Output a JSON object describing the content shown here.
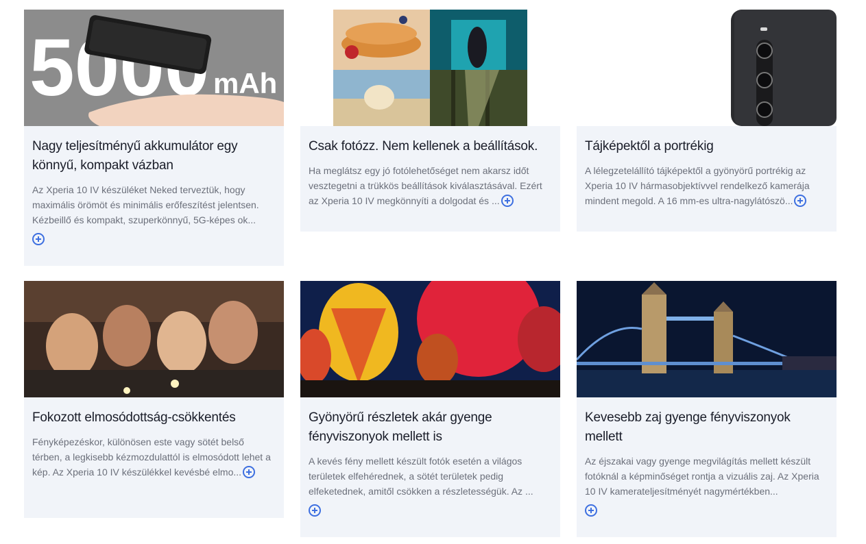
{
  "cards": [
    {
      "title": "Nagy teljesítményű akkumulátor egy könnyű, kompakt vázban",
      "text": "Az Xperia 10 IV készüléket Neked terveztük, hogy maximális örömöt és minimális erőfeszítést jelentsen. Kézbeillő és kompakt, szuperkönnyű, 5G-képes ok...",
      "image_label_big": "5000",
      "image_label_unit": "mAh",
      "more_icon": "plus-circle-icon"
    },
    {
      "title": "Csak fotózz. Nem kellenek a beállítások.",
      "text": "Ha meglátsz egy jó fotólehetőséget nem akarsz időt vesztegetni a trükkös beállítások kiválasztásával. Ezért az Xperia 10 IV megkönnyíti a dolgodat és ...",
      "more_icon": "plus-circle-icon"
    },
    {
      "title": "Tájképektől a portrékig",
      "text": "A lélegzetelállító tájképektől a gyönyörű portrékig az Xperia 10 IV hármasobjektívvel rendelkező kamerája mindent megold. A 16 mm-es ultra-nagylátószö...",
      "more_icon": "plus-circle-icon"
    },
    {
      "title": "Fokozott elmosódottság-csökkentés",
      "text": "Fényképezéskor, különösen este vagy sötét belső térben, a legkisebb kézmozdulattól is elmosódott lehet a kép. Az Xperia 10 IV készülékkel kevésbé elmo...",
      "more_icon": "plus-circle-icon"
    },
    {
      "title": "Gyönyörű részletek akár gyenge fényviszonyok mellett is",
      "text": "A kevés fény mellett készült fotók esetén a világos területek elfehérednek, a sötét területek pedig elfeketednek, amitől csökken a részletességük. Az ...",
      "more_icon": "plus-circle-icon"
    },
    {
      "title": "Kevesebb zaj gyenge fényviszonyok mellett",
      "text": "Az éjszakai vagy gyenge megvilágítás mellett készült fotóknál a képminőséget rontja a vizuális zaj. Az Xperia 10 IV kamerateljesítményét nagymértékben...",
      "more_icon": "plus-circle-icon"
    }
  ],
  "colors": {
    "card_bg": "#f1f4f9",
    "title": "#1a1d29",
    "text": "#6b6f7a",
    "accent": "#3d6fe0"
  }
}
